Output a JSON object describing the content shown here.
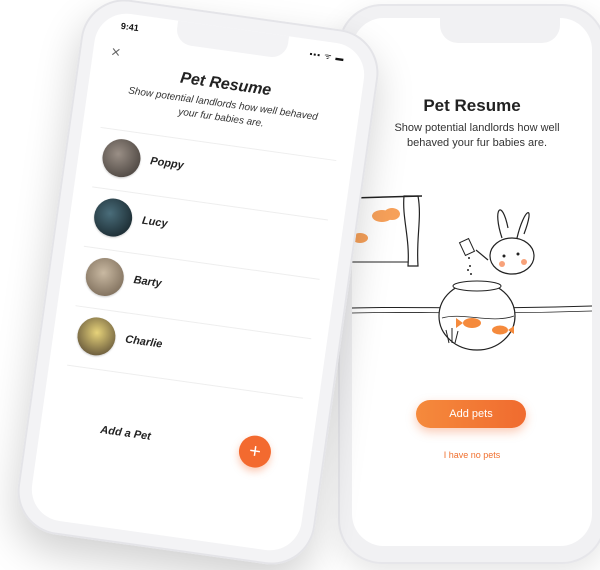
{
  "left_screen": {
    "status_time": "9:41",
    "status_icons": "▪▪▪ ᯤ ▬",
    "close_icon": "×",
    "title": "Pet Resume",
    "subtitle": "Show potential landlords how well behaved your fur babies are.",
    "pets": [
      {
        "name": "Poppy"
      },
      {
        "name": "Lucy"
      },
      {
        "name": "Barty"
      },
      {
        "name": "Charlie"
      }
    ],
    "add_pet_label": "Add a Pet",
    "fab_label": "+"
  },
  "right_screen": {
    "title": "Pet Resume",
    "subtitle": "Show potential landlords how well behaved your fur babies are.",
    "primary_button": "Add pets",
    "secondary_link": "I have no pets"
  },
  "colors": {
    "accent": "#f06b2f",
    "text": "#222222"
  }
}
